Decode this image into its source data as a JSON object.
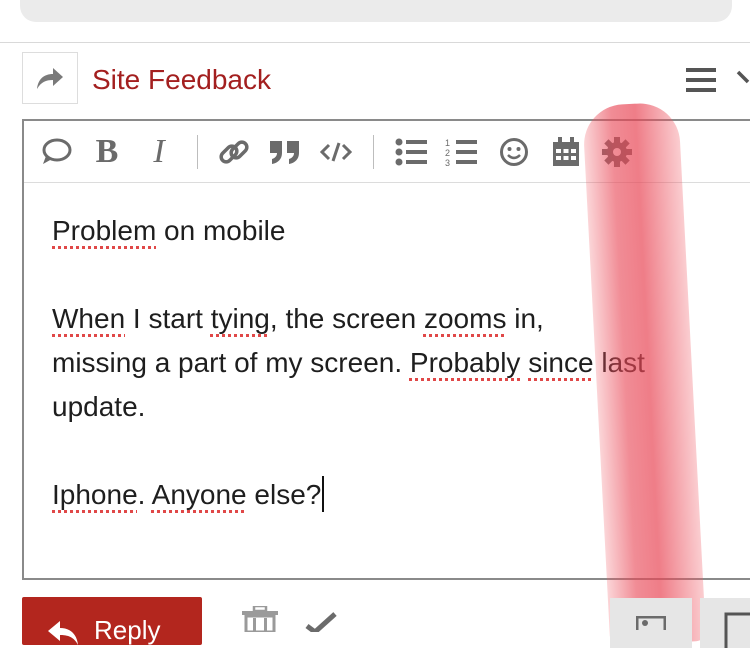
{
  "header": {
    "category_title": "Site Feedback",
    "icons": [
      "share-icon",
      "hamburger-menu-icon",
      "chevron-down-icon"
    ]
  },
  "toolbar": {
    "buttons": [
      "quote-icon",
      "bold-icon",
      "italic-icon",
      "link-icon",
      "blockquote-icon",
      "code-icon",
      "bullet-list-icon",
      "numbered-list-icon",
      "emoji-icon",
      "calendar-icon",
      "gear-icon"
    ],
    "bold_label": "B",
    "italic_label": "I"
  },
  "editor": {
    "title_word1": "Problem",
    "title_rest": " on mobile",
    "line1_a": "When",
    "line1_b": " I start ",
    "line1_c": "tying",
    "line1_d": ", the screen ",
    "line1_e": "zooms",
    "line1_f": " in,",
    "line2_a": "missing a part of my screen. ",
    "line2_b": "Probably",
    "line2_c": " ",
    "line2_d": "since",
    "line2_e": " last",
    "line3": "update.",
    "line4_a": "Iphone",
    "line4_b": ". ",
    "line4_c": "Anyone",
    "line4_d": " else?"
  },
  "footer": {
    "reply_label": "Reply"
  },
  "colors": {
    "brand_red": "#a31f1f",
    "reply_bg": "#b3261e",
    "highlight_mark": "#e84655"
  }
}
